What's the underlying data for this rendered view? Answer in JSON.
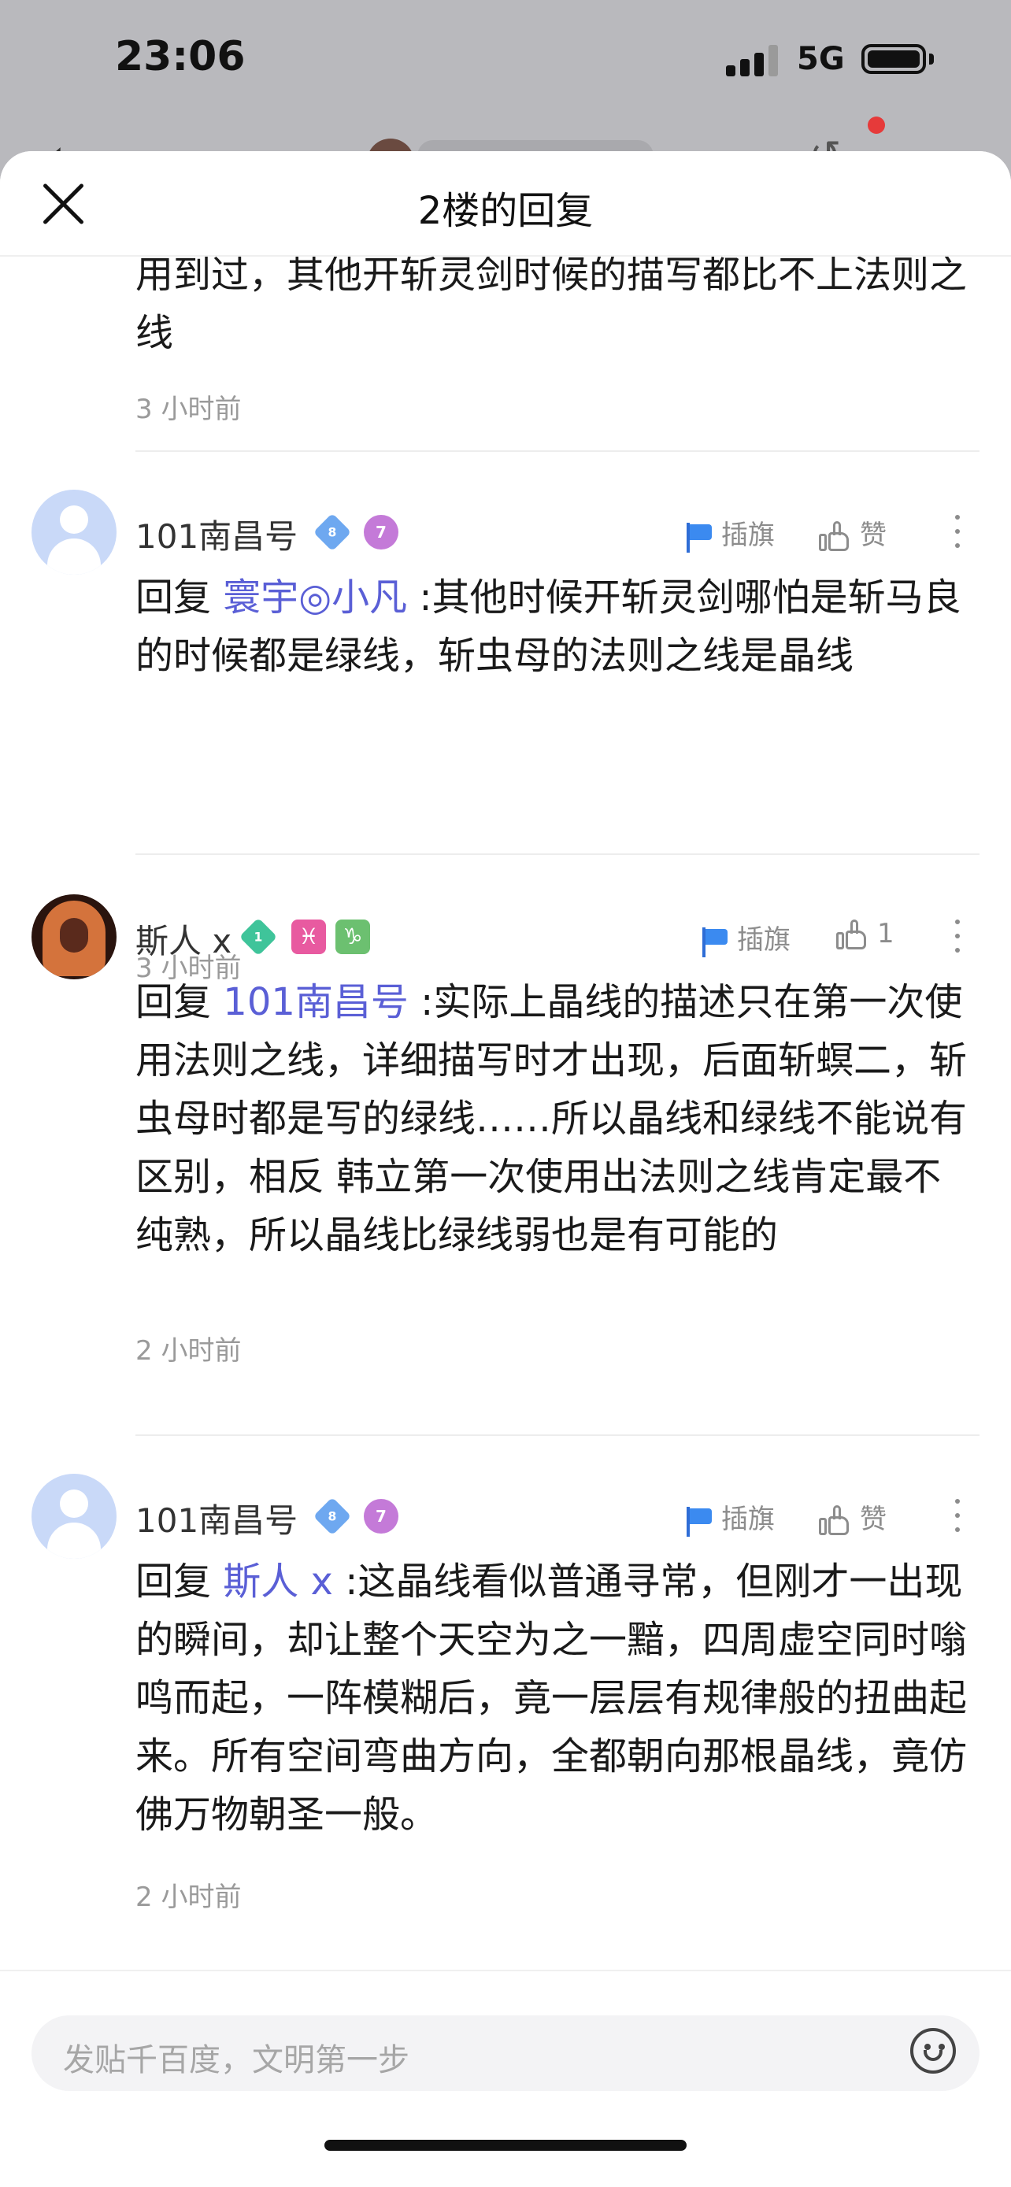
{
  "status": {
    "time": "23:06",
    "network": "5G"
  },
  "sheet": {
    "title": "2楼的回复"
  },
  "top_fragment": {
    "text": "用到过，其他开斩灵剑时候的描写都比不上法则之线",
    "time": "3 小时前"
  },
  "comments": [
    {
      "username": "101南昌号",
      "badges": [
        "8",
        "7"
      ],
      "flag_label": "插旗",
      "like_label": "赞",
      "reply_prefix": "回复",
      "mention": "寰宇◎小凡",
      "text": " :其他时候开斩灵剑哪怕是斩马良的时候都是绿线，斩虫母的法则之线是晶线",
      "time": "3 小时前"
    },
    {
      "username": "斯人 x",
      "badges": [
        "1",
        "♓",
        "♑"
      ],
      "flag_label": "插旗",
      "like_label": "1",
      "reply_prefix": "回复",
      "mention": "101南昌号",
      "text": " :实际上晶线的描述只在第一次使用法则之线，详细描写时才出现，后面斩螟二，斩虫母时都是写的绿线……所以晶线和绿线不能说有区别，相反 韩立第一次使用出法则之线肯定最不纯熟，所以晶线比绿线弱也是有可能的",
      "time": "2 小时前"
    },
    {
      "username": "101南昌号",
      "badges": [
        "8",
        "7"
      ],
      "flag_label": "插旗",
      "like_label": "赞",
      "reply_prefix": "回复",
      "mention": "斯人 x",
      "text": " :这晶线看似普通寻常，但刚才一出现的瞬间，却让整个天空为之一黯，四周虚空同时嗡鸣而起，一阵模糊后，竟一层层有规律般的扭曲起来。所有空间弯曲方向，全都朝向那根晶线，竟仿佛万物朝圣一般。",
      "time": "2 小时前"
    }
  ],
  "input": {
    "placeholder": "发贴千百度，文明第一步"
  },
  "colors": {
    "mention": "#5a5fd6",
    "accent_dot": "#e63a3a"
  }
}
